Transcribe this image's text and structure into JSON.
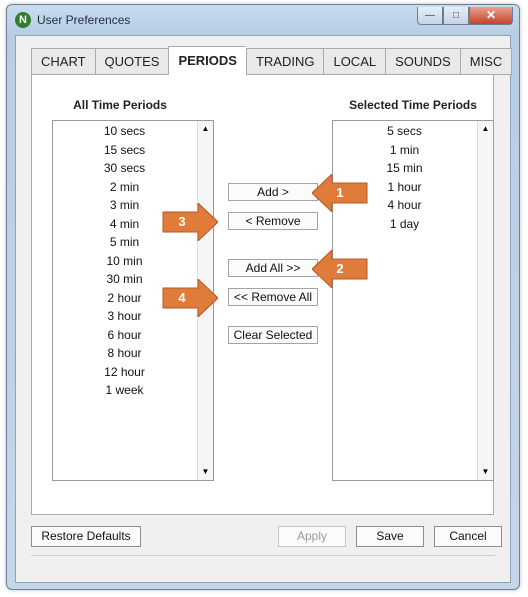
{
  "window": {
    "title": "User Preferences",
    "app_icon": "N",
    "minimize_glyph": "—",
    "maximize_glyph": "□",
    "close_glyph": "✕"
  },
  "tabs": [
    {
      "label": "CHART",
      "active": false
    },
    {
      "label": "QUOTES",
      "active": false
    },
    {
      "label": "PERIODS",
      "active": true
    },
    {
      "label": "TRADING",
      "active": false
    },
    {
      "label": "LOCAL",
      "active": false
    },
    {
      "label": "SOUNDS",
      "active": false
    },
    {
      "label": "MISC",
      "active": false
    }
  ],
  "periods": {
    "all_title": "All Time Periods",
    "selected_title": "Selected Time Periods",
    "all": [
      "10 secs",
      "15 secs",
      "30 secs",
      "2 min",
      "3 min",
      "4 min",
      "5 min",
      "10 min",
      "30 min",
      "2 hour",
      "3 hour",
      "6 hour",
      "8 hour",
      "12 hour",
      "1 week"
    ],
    "selected": [
      "5 secs",
      "1 min",
      "15 min",
      "1 hour",
      "4 hour",
      "1 day"
    ],
    "scroll_up": "▲",
    "scroll_down": "▼"
  },
  "buttons": {
    "add": "Add >",
    "remove": "< Remove",
    "add_all": "Add All >>",
    "remove_all": "<< Remove All",
    "clear_selected": "Clear Selected"
  },
  "callouts": {
    "color": "#e07b39",
    "labels": [
      "1",
      "2",
      "3",
      "4"
    ]
  },
  "footer": {
    "restore_defaults": "Restore Defaults",
    "apply": "Apply",
    "save": "Save",
    "cancel": "Cancel"
  }
}
